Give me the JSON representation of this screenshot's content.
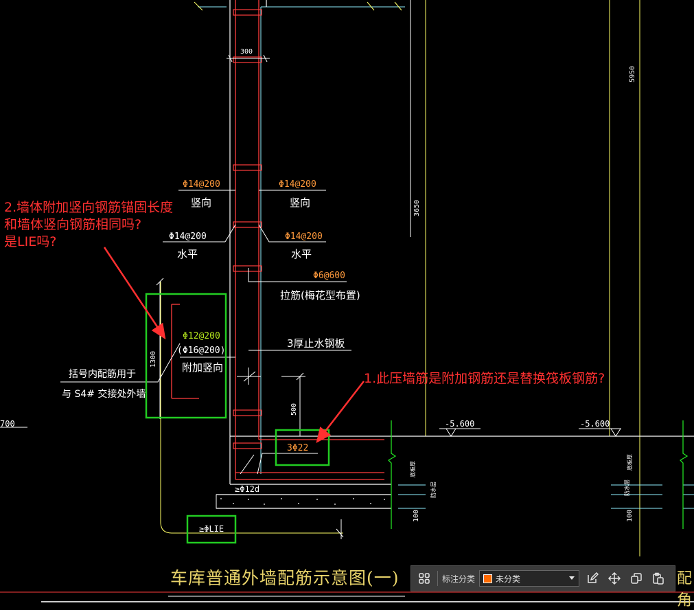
{
  "drawing": {
    "dims": {
      "d300": "300",
      "d5950": "5950",
      "d3650": "3650",
      "d1300": "1300",
      "d500": "500",
      "d100a": "100",
      "d100b": "100",
      "d700": "700"
    },
    "labels": {
      "vert_left_code": "Φ14@200",
      "vert_left_text": "竖向",
      "vert_right_code": "Φ14@200",
      "vert_right_text": "竖向",
      "horiz_left_code": "Φ14@200",
      "horiz_left_text": "水平",
      "horiz_right_code": "Φ14@200",
      "horiz_right_text": "水平",
      "tie_code": "Φ6@600",
      "tie_text": "拉筋(梅花型布置)",
      "add_code1": "Φ12@200",
      "add_code2": "(Φ16@200)",
      "add_text": "附加竖向",
      "waterstop": "3厚止水钢板",
      "bracket_note1": "括号内配筋用于",
      "bracket_note2": "与 S4# 交接处外墙",
      "press_bar": "3Φ22",
      "anchor_12d": "≥Φ12d",
      "anchor_lie": "≥ΦLIE",
      "elev1": "-5.600",
      "elev2": "-5.600",
      "raft_a": "底板厚",
      "raft_b": "底板厚",
      "water_a": "防水层",
      "water_b": "防水层"
    },
    "title": "车库普通外墙配筋示意图(一)",
    "title_cut": "配角"
  },
  "annotations": {
    "note2": [
      "2.墙体附加竖向钢筋锚固长度",
      "和墙体竖向钢筋相同吗?",
      "是LIE吗?"
    ],
    "note1": "1.此压墙筋是附加钢筋还是替换筏板钢筋?"
  },
  "toolbar": {
    "label": "标注分类",
    "select_value": "未分类",
    "swatch_color": "#ff6a00"
  },
  "colors": {
    "wall": "#ff3d3d",
    "rebar_label": "#ff9a3c",
    "green_label": "#b5e61d",
    "line": "#ffffff",
    "yellow": "#ffff66",
    "cyan": "#8ff0ff",
    "box": "#22cc22",
    "note": "#ff3030"
  }
}
